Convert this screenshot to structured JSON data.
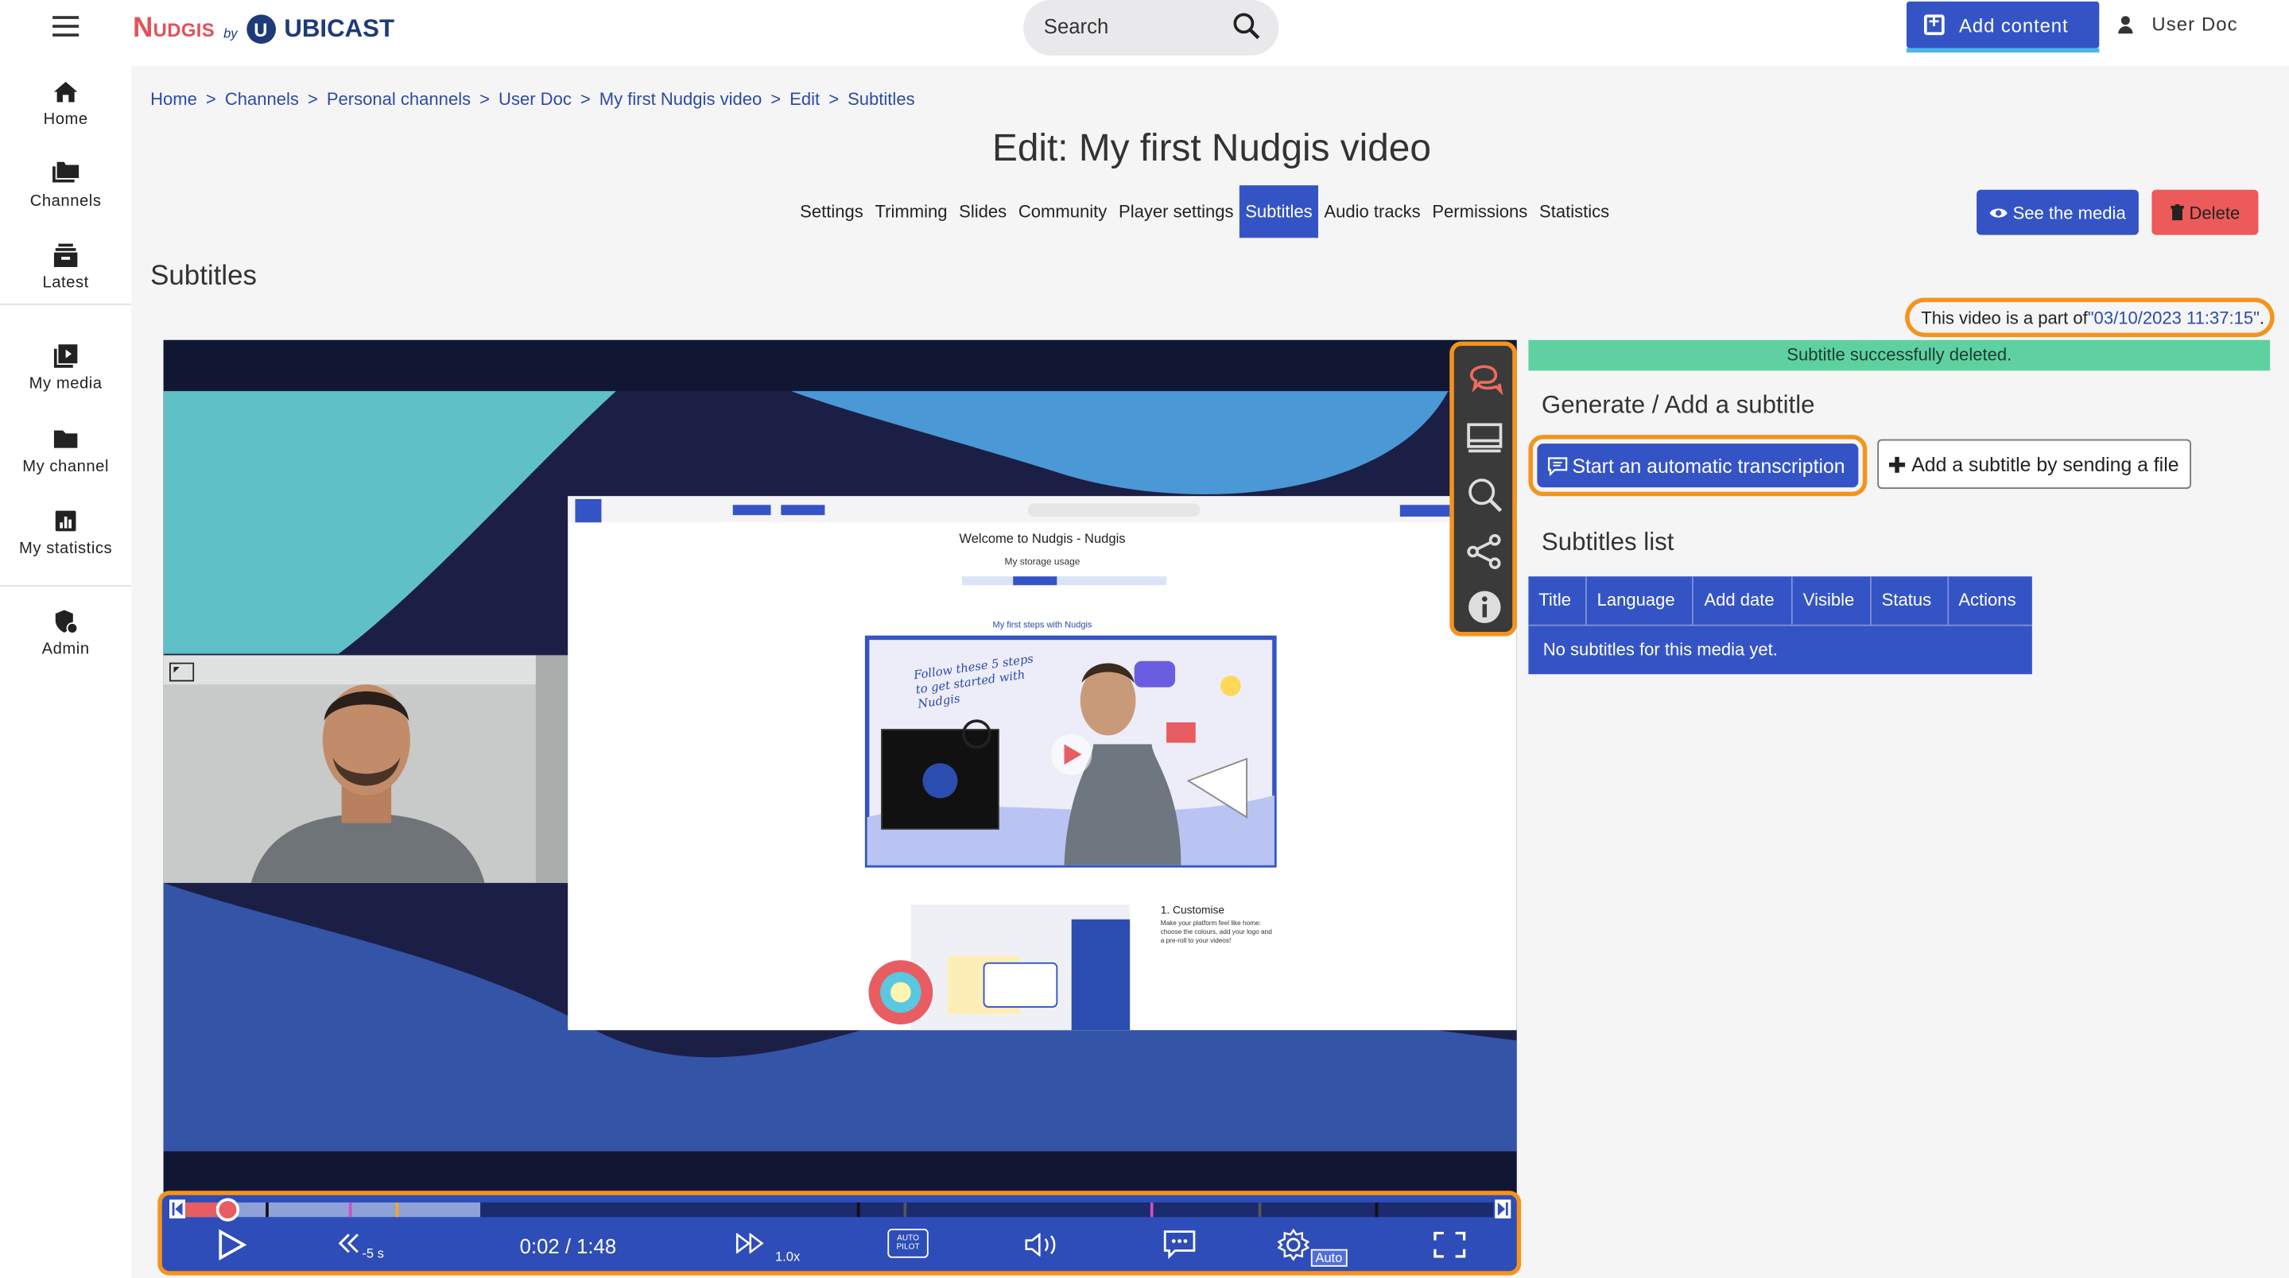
{
  "header": {
    "logo_brand": "Nudgis",
    "logo_by": "by",
    "logo_company": "UBICAST",
    "search_label": "Search",
    "add_content_label": "Add content",
    "user_label": "User Doc"
  },
  "sidebar": {
    "items": [
      {
        "label": "Home",
        "icon": "home-icon"
      },
      {
        "label": "Channels",
        "icon": "folders-icon"
      },
      {
        "label": "Latest",
        "icon": "latest-icon"
      },
      {
        "label": "My media",
        "icon": "media-icon"
      },
      {
        "label": "My channel",
        "icon": "folder-icon"
      },
      {
        "label": "My statistics",
        "icon": "stats-icon"
      },
      {
        "label": "Admin",
        "icon": "admin-shield-icon"
      }
    ]
  },
  "breadcrumb": [
    "Home",
    "Channels",
    "Personal channels",
    "User Doc",
    "My first Nudgis video",
    "Edit",
    "Subtitles"
  ],
  "breadcrumb_sep": ">",
  "page_title": "Edit: My first Nudgis video",
  "tabs": [
    {
      "label": "Settings",
      "active": false
    },
    {
      "label": "Trimming",
      "active": false
    },
    {
      "label": "Slides",
      "active": false
    },
    {
      "label": "Community",
      "active": false
    },
    {
      "label": "Player settings",
      "active": false
    },
    {
      "label": "Subtitles",
      "active": true
    },
    {
      "label": "Audio tracks",
      "active": false
    },
    {
      "label": "Permissions",
      "active": false
    },
    {
      "label": "Statistics",
      "active": false
    }
  ],
  "actions": {
    "see_media_label": "See the media",
    "delete_label": "Delete"
  },
  "section_title": "Subtitles",
  "video_part": {
    "prefix": "This video is a part of ",
    "link": "\"03/10/2023 11:37:15\"",
    "suffix": "."
  },
  "player": {
    "time": "0:02 / 1:48",
    "rewind_label": "-5 s",
    "speed_label": "1.0x",
    "autopilot_label": "AUTO PILOT",
    "quality_label": "Auto",
    "progress_played": 0.03,
    "progress_buffered": 0.225,
    "slide": {
      "title": "Welcome to Nudgis - Nudgis",
      "storage": "My storage usage",
      "steps_link": "My first steps with Nudgis",
      "handwritten": "Follow these 5 steps to get started with Nudgis",
      "customise_title": "1. Customise",
      "customise_text": "Make your platform feel like home: choose the colours, add your logo and a pre-roll to your videos!"
    }
  },
  "right_panel": {
    "success_message": "Subtitle successfully deleted.",
    "generate_title": "Generate / Add a subtitle",
    "auto_transcription_label": "Start an automatic transcription",
    "add_file_label": "Add a subtitle by sending a file",
    "list_title": "Subtitles list",
    "table_headers": [
      "Title",
      "Language",
      "Add date",
      "Visible",
      "Status",
      "Actions"
    ],
    "empty_message": "No subtitles for this media yet."
  },
  "colors": {
    "accent": "#3454c6",
    "brand_red": "#e3505a",
    "highlight": "#f5931e",
    "success": "#5fd1a1",
    "danger": "#ec5a5a"
  }
}
